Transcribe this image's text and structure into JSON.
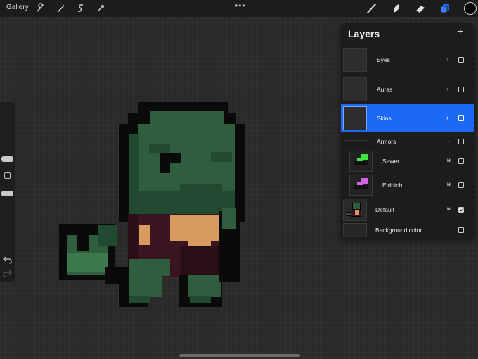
{
  "topbar": {
    "gallery_label": "Gallery",
    "menu_dots": "•••",
    "left_tools": [
      "wrench-icon",
      "magic-wand-icon",
      "selection-icon",
      "transform-arrow-icon"
    ],
    "right_tools": [
      "brush-icon",
      "smudge-icon",
      "eraser-icon",
      "layers-icon"
    ],
    "active_color": "#000000",
    "active_tool_color": "#1e68f6"
  },
  "sidebar": {
    "icons": [
      "undo-icon",
      "redo-icon"
    ]
  },
  "layers": {
    "title": "Layers",
    "add_label": "+",
    "items": [
      {
        "name": "Eyes",
        "chevron": "›",
        "visible": false
      },
      {
        "name": "Auras",
        "chevron": "›",
        "visible": false
      },
      {
        "name": "Skins",
        "chevron": "›",
        "visible": false,
        "selected": true
      },
      {
        "name": "Armors",
        "chevron": "⌄",
        "visible": false,
        "group": true
      },
      {
        "name": "Sewer",
        "blend": "N",
        "visible": false,
        "accent": "#3ee63e"
      },
      {
        "name": "Eldritch",
        "blend": "N",
        "visible": false,
        "accent": "#d65fe6"
      },
      {
        "name": "Default",
        "blend": "N",
        "visible": true
      },
      {
        "name": "Background color",
        "visible": false
      }
    ]
  },
  "sprite_colors": {
    "outline": "#0a0a0a",
    "skin": "#2e5e3e",
    "skin_highlight": "#3c7a4e",
    "skin_shadow": "#224a30",
    "armor_red": "#3a1420",
    "armor_shadow": "#2a0e16",
    "belly": "#d89a5e"
  }
}
